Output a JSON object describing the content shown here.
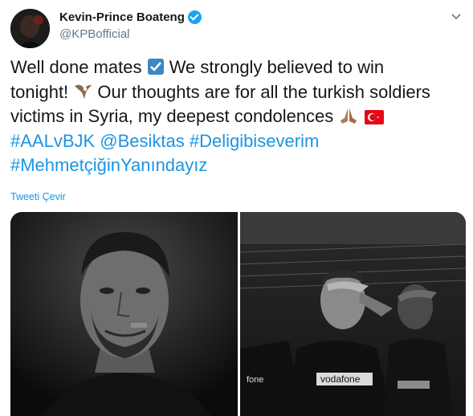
{
  "tweet": {
    "author_name": "Kevin-Prince Boateng",
    "author_handle": "@KPBofficial",
    "text_lines": [
      {
        "a": "Well done mates ",
        "b": " We strongly believed to win"
      },
      {
        "a": "tonight! ",
        "b": "  Our thoughts are for all the turkish soldiers"
      },
      {
        "a": "victims in Syria, my deepest condolences "
      }
    ],
    "hashtags_line1": [
      "#AALvBJK",
      "@Besiktas",
      "#Deligibiseverim"
    ],
    "hashtags_line2": [
      "#MehmetçiğinYanındayız"
    ],
    "translate_label": "Tweeti Çevir"
  },
  "media": {
    "photo1_text": "",
    "photo2_sponsor": "vodafone"
  },
  "icons": {
    "verified": "verified-badge-icon",
    "chevron": "chevron-down-icon",
    "check": "checkbox-emoji-icon",
    "eagle": "eagle-emoji-icon",
    "pray": "folded-hands-emoji-icon",
    "flag": "turkey-flag-emoji-icon"
  },
  "colors": {
    "link": "#1b95e0",
    "verified": "#1da1f2",
    "secondary": "#657786"
  }
}
